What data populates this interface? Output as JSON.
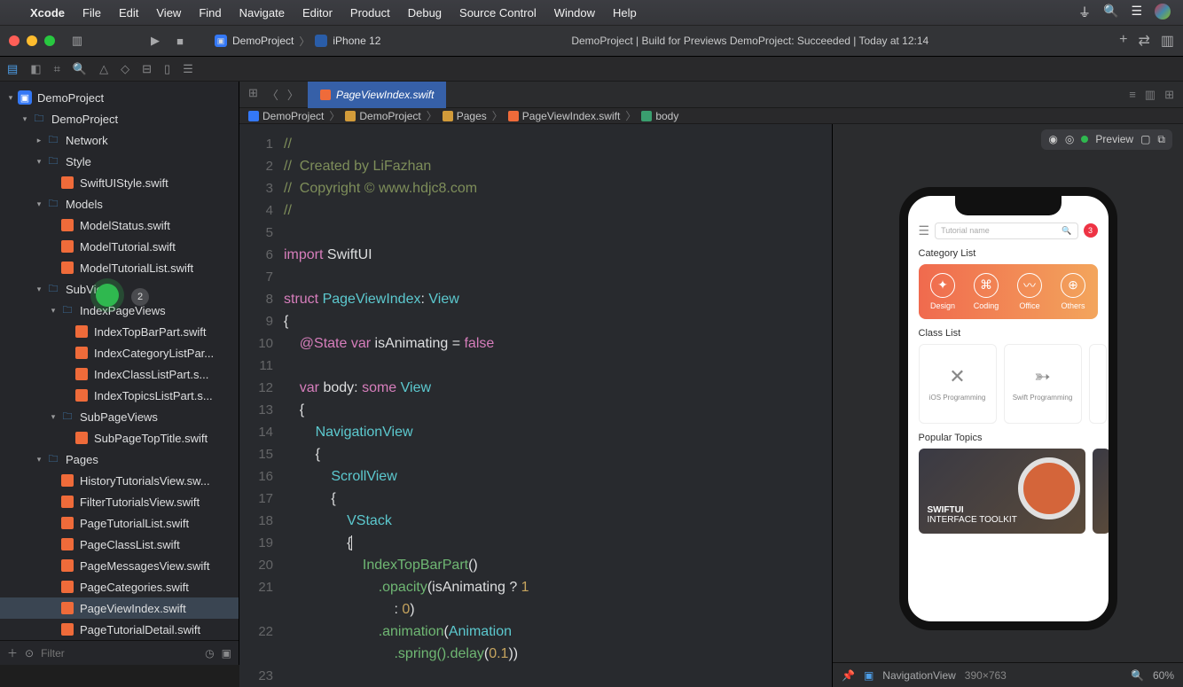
{
  "menubar": {
    "app": "Xcode",
    "items": [
      "File",
      "Edit",
      "View",
      "Find",
      "Navigate",
      "Editor",
      "Product",
      "Debug",
      "Source Control",
      "Window",
      "Help"
    ]
  },
  "toolbar": {
    "scheme_project": "DemoProject",
    "scheme_device": "iPhone 12",
    "status": "DemoProject | Build for Previews DemoProject: Succeeded | Today at 12:14"
  },
  "tab": {
    "title": "PageViewIndex.swift"
  },
  "breadcrumb": {
    "items": [
      "DemoProject",
      "DemoProject",
      "Pages",
      "PageViewIndex.swift",
      "body"
    ]
  },
  "tree": {
    "badge_count": "2",
    "root": "DemoProject",
    "folders": {
      "demoproject": "DemoProject",
      "network": "Network",
      "style": "Style",
      "models": "Models",
      "subviews": "SubViews",
      "indexpageviews": "IndexPageViews",
      "subpageviews": "SubPageViews",
      "pages": "Pages"
    },
    "files": {
      "swiftStyle": "SwiftUIStyle.swift",
      "modelStatus": "ModelStatus.swift",
      "modelTutorial": "ModelTutorial.swift",
      "modelTutorialList": "ModelTutorialList.swift",
      "indexTopBar": "IndexTopBarPart.swift",
      "indexCategory": "IndexCategoryListPar...",
      "indexClass": "IndexClassListPart.s...",
      "indexTopics": "IndexTopicsListPart.s...",
      "subPageTop": "SubPageTopTitle.swift",
      "history": "HistoryTutorialsView.sw...",
      "filter": "FilterTutorialsView.swift",
      "pageTutList": "PageTutorialList.swift",
      "pageClassList": "PageClassList.swift",
      "pageMessages": "PageMessagesView.swift",
      "pageCategories": "PageCategories.swift",
      "pageViewIndex": "PageViewIndex.swift",
      "pageTutDetail": "PageTutorialDetail.swift"
    }
  },
  "filter": {
    "placeholder": "Filter"
  },
  "code": {
    "l1": "//",
    "l2a": "//",
    "l2b": "  Created by LiFazhan",
    "l3a": "//",
    "l3b": "  Copyright © www.hdjc8.com",
    "l4": "//",
    "import": "import",
    "swiftui": "SwiftUI",
    "struct": "struct",
    "pagename": "PageViewIndex",
    "view": "View",
    "state": "@State",
    "var": "var",
    "isAnim": "isAnimating",
    "eq": "=",
    "false": "false",
    "body": "body",
    "some": "some",
    "navview": "NavigationView",
    "scrollview": "ScrollView",
    "vstack": "VStack",
    "indextop": "IndexTopBarPart",
    "paren": "()",
    "opacity": ".opacity",
    "isAnimRef": "isAnimating",
    "q": "?",
    "one": "1",
    "colon": ":",
    "zero": "0",
    "animation": ".animation",
    "animType": "Animation",
    "spring": ".spring()",
    "delay": ".delay",
    "dval": "0.1"
  },
  "preview": {
    "label": "Preview",
    "search_placeholder": "Tutorial name",
    "notif": "3",
    "cat_title": "Category List",
    "cats": [
      "Design",
      "Coding",
      "Office",
      "Others"
    ],
    "class_title": "Class List",
    "classes": [
      "iOS Programming",
      "Swift Programming"
    ],
    "topic_title": "Popular Topics",
    "topic1a": "SWIFTUI",
    "topic1b": "INTERFACE TOOLKIT",
    "bottom_view": "NavigationView",
    "bottom_size": "390×763",
    "zoom": "60%"
  }
}
